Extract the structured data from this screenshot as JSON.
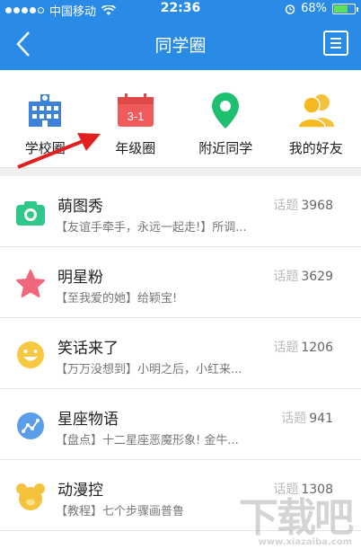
{
  "status_bar": {
    "carrier": "中国移动",
    "time": "22:36",
    "battery": "68%",
    "signal_bars": 5,
    "signal_filled": 4,
    "battery_level": 0.68
  },
  "nav": {
    "title": "同学圈",
    "back_icon": "chevron-left-icon",
    "menu_icon": "list-menu-icon"
  },
  "shortcuts": [
    {
      "label": "学校圈",
      "icon": "school-building-icon",
      "color": "#3b82d8"
    },
    {
      "label": "年级圈",
      "icon": "calendar-grade-icon",
      "color": "#ef5b5b",
      "icon_text": "3-1"
    },
    {
      "label": "附近同学",
      "icon": "location-pin-icon",
      "color": "#1fbf70"
    },
    {
      "label": "我的好友",
      "icon": "friends-icon",
      "color": "#f5b820"
    }
  ],
  "topic_label": "话题",
  "groups": [
    {
      "name": "萌图秀",
      "topics": "3968",
      "desc": "【友谊手牵手，永远一起走!】所调...",
      "icon": "camera-icon",
      "color": "#2fc88a"
    },
    {
      "name": "明星粉",
      "topics": "3629",
      "desc": "【至我爱的她】给颖宝!",
      "icon": "star-icon",
      "color": "#f0667a"
    },
    {
      "name": "笑话来了",
      "topics": "1206",
      "desc": "【万万没想到】小明之后，小红来...",
      "icon": "smiley-icon",
      "color": "#f7c842"
    },
    {
      "name": "星座物语",
      "topics": "941",
      "desc": "【盘点】十二星座恶魔形象! 金牛...",
      "icon": "constellation-icon",
      "color": "#5a9de8"
    },
    {
      "name": "动漫控",
      "topics": "1308",
      "desc": "【教程】七个步骤画普鲁",
      "icon": "bear-icon",
      "color": "#f5c23e"
    }
  ],
  "watermark": {
    "text": "下载吧",
    "url": "www.xiazaiba.com"
  }
}
